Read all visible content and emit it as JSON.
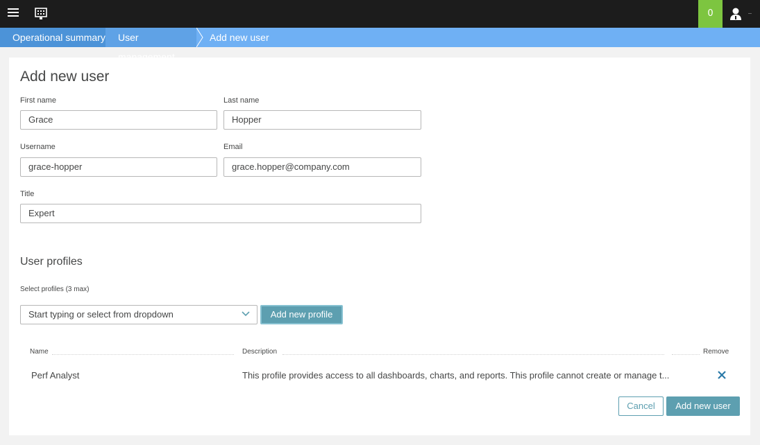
{
  "header": {
    "notification_count": "0",
    "icons": [
      "menu-icon",
      "monitor-icon",
      "user-icon"
    ]
  },
  "breadcrumb": {
    "items": [
      "Operational summary",
      "User management",
      "Add new user"
    ]
  },
  "page": {
    "title": "Add new user"
  },
  "form": {
    "first_name": {
      "label": "First name",
      "value": "Grace"
    },
    "last_name": {
      "label": "Last name",
      "value": "Hopper"
    },
    "username": {
      "label": "Username",
      "value": "grace-hopper"
    },
    "email": {
      "label": "Email",
      "value": "grace.hopper@company.com"
    },
    "title": {
      "label": "Title",
      "value": "Expert"
    }
  },
  "profiles": {
    "section_title": "User profiles",
    "select_label": "Select profiles (3 max)",
    "select_placeholder": "Start typing or select from dropdown",
    "add_profile_label": "Add new profile",
    "table": {
      "headers": {
        "name": "Name",
        "description": "Description",
        "remove": "Remove"
      },
      "rows": [
        {
          "name": "Perf Analyst",
          "description": "This profile provides access to all dashboards, charts, and reports. This profile cannot create or manage t..."
        }
      ]
    }
  },
  "actions": {
    "cancel": "Cancel",
    "submit": "Add new user"
  },
  "colors": {
    "topbar": "#1c1c1c",
    "badge": "#7dc540",
    "breadcrumb": "#6fb0f4",
    "primary_button": "#5d9fb0",
    "remove_x": "#2b7aa8"
  }
}
